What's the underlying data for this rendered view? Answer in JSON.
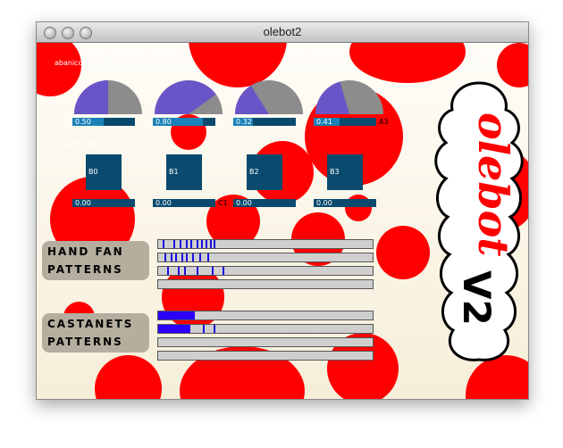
{
  "window": {
    "title": "olebot2"
  },
  "sections": {
    "fans": "abanicos",
    "castanets": "castañuelas"
  },
  "gauges": [
    {
      "value": 0.5,
      "display": "0.50",
      "label": ""
    },
    {
      "value": 0.8,
      "display": "0.80",
      "label": ""
    },
    {
      "value": 0.32,
      "display": "0.32",
      "label": ""
    },
    {
      "value": 0.41,
      "display": "0.41",
      "label": "A3"
    }
  ],
  "pads": [
    {
      "name": "B0",
      "value": "0.00",
      "label": ""
    },
    {
      "name": "B1",
      "value": "0.00",
      "label": "C1"
    },
    {
      "name": "B2",
      "value": "0.00",
      "label": ""
    },
    {
      "name": "B3",
      "value": "0.00",
      "label": ""
    }
  ],
  "patterns": {
    "fan_label_1": "HAND FAN",
    "fan_label_2": "PATTERNS",
    "cast_label_1": "CASTANETS",
    "cast_label_2": "PATTERNS",
    "fan_rows": [
      {
        "ticks": [
          0.02,
          0.07,
          0.1,
          0.13,
          0.15,
          0.18,
          0.2,
          0.22,
          0.24,
          0.26
        ]
      },
      {
        "ticks": [
          0.03,
          0.06,
          0.08,
          0.11,
          0.13,
          0.16,
          0.19,
          0.23
        ]
      },
      {
        "ticks": [
          0.04,
          0.09,
          0.12,
          0.18,
          0.25,
          0.3
        ]
      },
      {
        "ticks": []
      }
    ],
    "cast_rows": [
      {
        "solid": 0.17,
        "ticks": []
      },
      {
        "solid": 0.15,
        "ticks": [
          0.21,
          0.26
        ]
      },
      {
        "solid": 0,
        "ticks": []
      },
      {
        "solid": 0,
        "ticks": []
      }
    ]
  },
  "logo": {
    "main": "olebot",
    "version": "V2"
  },
  "colors": {
    "red": "#ff0000",
    "slider": "#0a4a6e",
    "gauge_fill": "#6a55c8",
    "tick": "#1a10e0"
  }
}
